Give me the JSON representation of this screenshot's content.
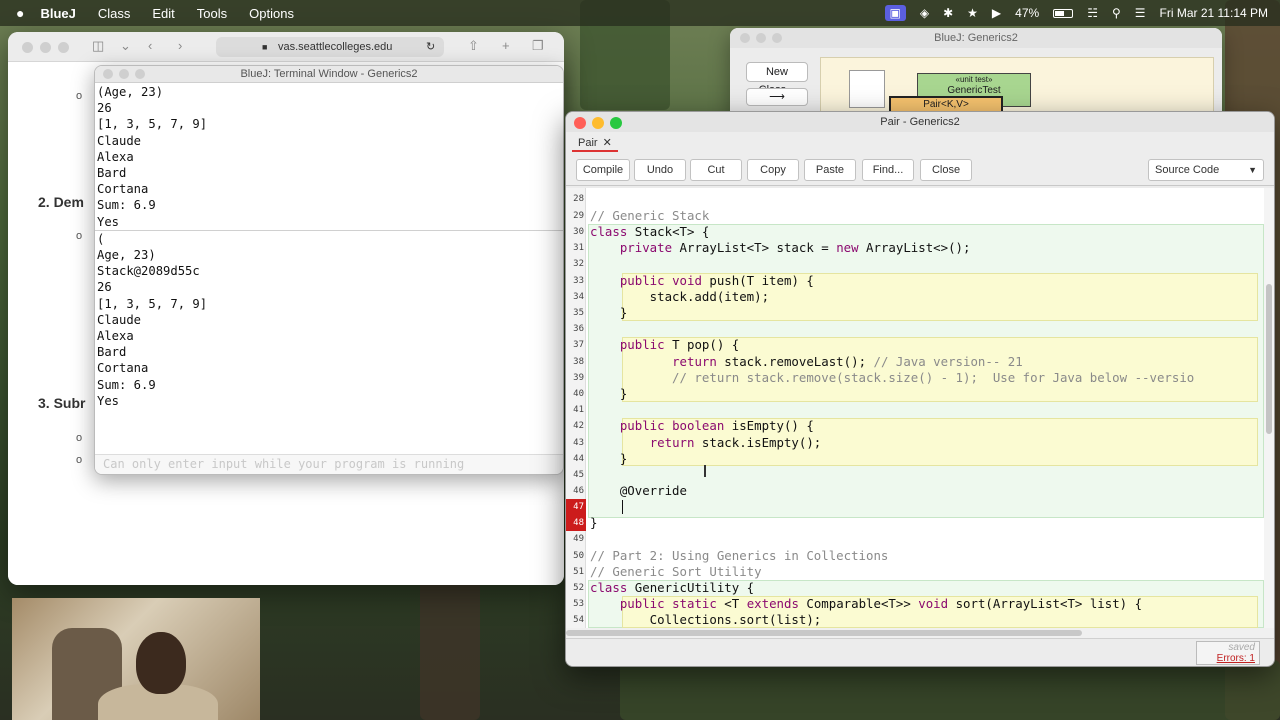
{
  "menubar": {
    "app_name": "BlueJ",
    "items": [
      "Class",
      "Edit",
      "Tools",
      "Options"
    ],
    "battery": "47%",
    "datetime": "Fri Mar 21  11:14 PM"
  },
  "safari": {
    "url": "vas.seattlecolleges.edu",
    "headings": [
      "2.  Dem",
      "3.  Subr"
    ]
  },
  "terminal": {
    "title": "BlueJ: Terminal Window - Generics2",
    "output_1": [
      "(Age, 23)",
      "26",
      "[1, 3, 5, 7, 9]",
      "Claude",
      "Alexa",
      "Bard",
      "Cortana",
      "Sum: 6.9",
      "Yes"
    ],
    "output_2": [
      "(",
      "Age, 23)",
      "Stack@2089d55c",
      "26",
      "[1, 3, 5, 7, 9]",
      "Claude",
      "Alexa",
      "Bard",
      "Cortana",
      "Sum: 6.9",
      "Yes"
    ],
    "input_placeholder": "Can only enter input while your program is running"
  },
  "bluej_main": {
    "title": "BlueJ:  Generics2",
    "new_class_label": "New Class...",
    "arrow_label": "⟶",
    "unit_test_stereotype": "«unit test»",
    "unit_test_name": "GenericTest",
    "class_name": "Pair<K,V>"
  },
  "editor": {
    "title": "Pair - Generics2",
    "tab_label": "Pair",
    "toolbar": {
      "compile": "Compile",
      "undo": "Undo",
      "cut": "Cut",
      "copy": "Copy",
      "paste": "Paste",
      "find": "Find...",
      "close": "Close",
      "view_mode": "Source Code"
    },
    "line_numbers": [
      "28",
      "29",
      "30",
      "31",
      "32",
      "33",
      "34",
      "35",
      "36",
      "37",
      "38",
      "39",
      "40",
      "41",
      "42",
      "43",
      "44",
      "45",
      "46",
      "47",
      "48",
      "49",
      "50",
      "51",
      "52",
      "53",
      "54"
    ],
    "status_saved": "saved",
    "status_errors": "Errors: 1"
  }
}
